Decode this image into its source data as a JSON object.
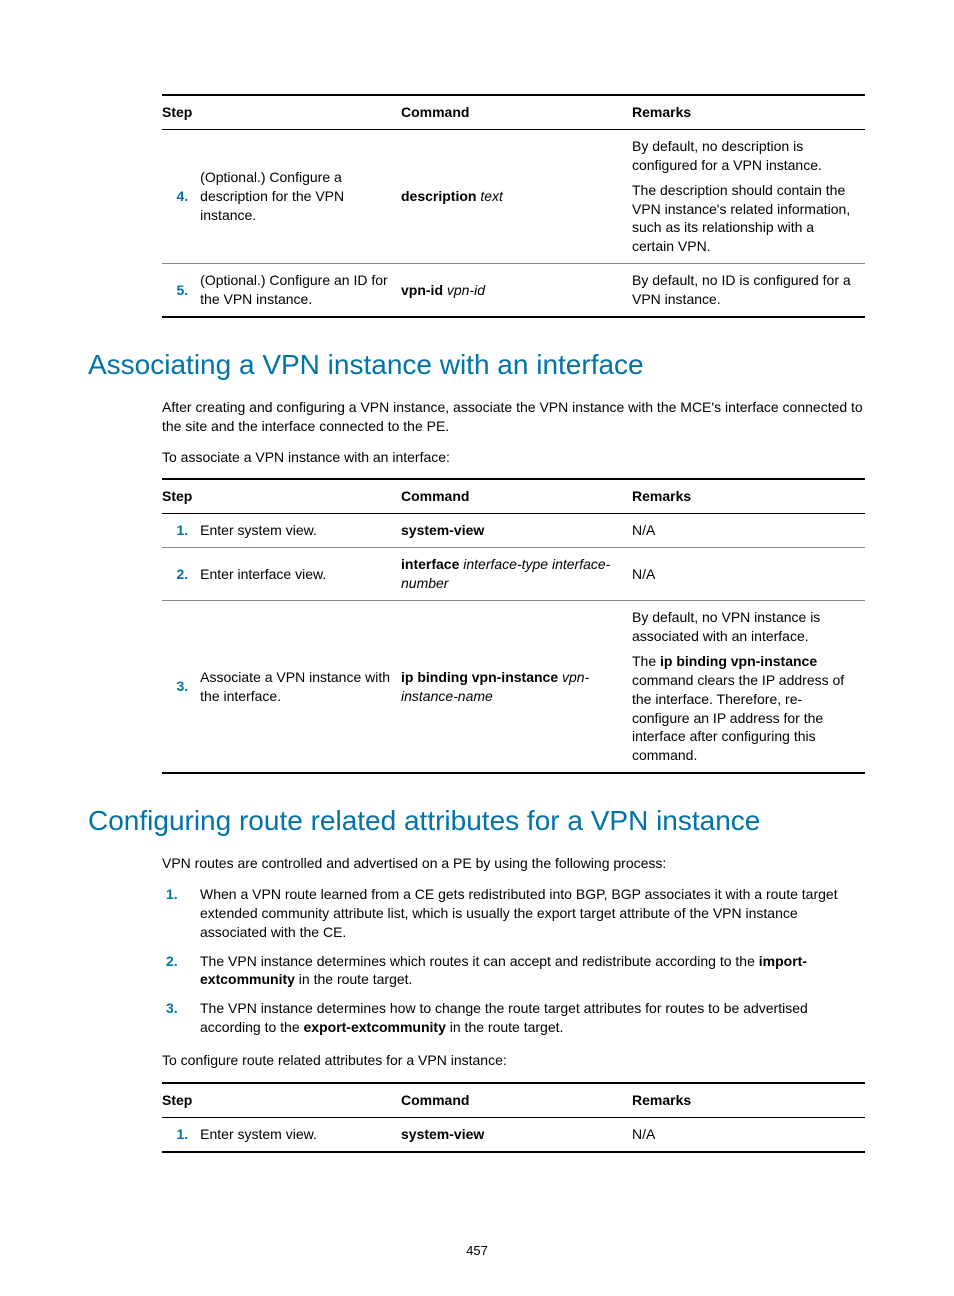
{
  "page_number": "457",
  "table1": {
    "headers": {
      "step": "Step",
      "command": "Command",
      "remarks": "Remarks"
    },
    "rows": [
      {
        "num": "4.",
        "step": "(Optional.) Configure a description for the VPN instance.",
        "cmd_bold": "description",
        "cmd_ital": " text",
        "remarks": [
          "By default, no description is configured for a VPN instance.",
          "The description should contain the VPN instance's related information, such as its relationship with a certain VPN."
        ]
      },
      {
        "num": "5.",
        "step": "(Optional.) Configure an ID for the VPN instance.",
        "cmd_bold": "vpn-id",
        "cmd_ital": " vpn-id",
        "remarks": [
          "By default, no ID is configured for a VPN instance."
        ]
      }
    ]
  },
  "section1": {
    "heading": "Associating a VPN instance with an interface",
    "para1": "After creating and configuring a VPN instance, associate the VPN instance with the MCE's interface connected to the site and the interface connected to the PE.",
    "para2": "To associate a VPN instance with an interface:"
  },
  "table2": {
    "headers": {
      "step": "Step",
      "command": "Command",
      "remarks": "Remarks"
    },
    "rows": [
      {
        "num": "1.",
        "step": "Enter system view.",
        "cmd_bold": "system-view",
        "cmd_ital": "",
        "remarks_plain": "N/A"
      },
      {
        "num": "2.",
        "step": "Enter interface view.",
        "cmd_bold": "interface",
        "cmd_ital": " interface-type interface-number",
        "remarks_plain": "N/A"
      },
      {
        "num": "3.",
        "step": "Associate a VPN instance with the interface.",
        "cmd_bold": "ip binding vpn-instance",
        "cmd_ital": " vpn-instance-name",
        "remarks": [
          "By default, no VPN instance is associated with an interface."
        ],
        "remark_rich_pre": "The ",
        "remark_rich_bold": "ip binding vpn-instance",
        "remark_rich_post": " command clears the IP address of the interface. Therefore, re-configure an IP address for the interface after configuring this command."
      }
    ]
  },
  "section2": {
    "heading": "Configuring route related attributes for a VPN instance",
    "para1": "VPN routes are controlled and advertised on a PE by using the following process:",
    "list": [
      {
        "text": "When a VPN route learned from a CE gets redistributed into BGP, BGP associates it with a route target extended community attribute list, which is usually the export target attribute of the VPN instance associated with the CE."
      },
      {
        "pre": "The VPN instance determines which routes it can accept and redistribute according to the ",
        "bold": "import-extcommunity",
        "post": " in the route target."
      },
      {
        "pre": "The VPN instance determines how to change the route target attributes for routes to be advertised according to the ",
        "bold": "export-extcommunity",
        "post": " in the route target."
      }
    ],
    "para2": "To configure route related attributes for a VPN instance:"
  },
  "table3": {
    "headers": {
      "step": "Step",
      "command": "Command",
      "remarks": "Remarks"
    },
    "rows": [
      {
        "num": "1.",
        "step": "Enter system view.",
        "cmd_bold": "system-view",
        "cmd_ital": "",
        "remarks_plain": "N/A"
      }
    ]
  }
}
